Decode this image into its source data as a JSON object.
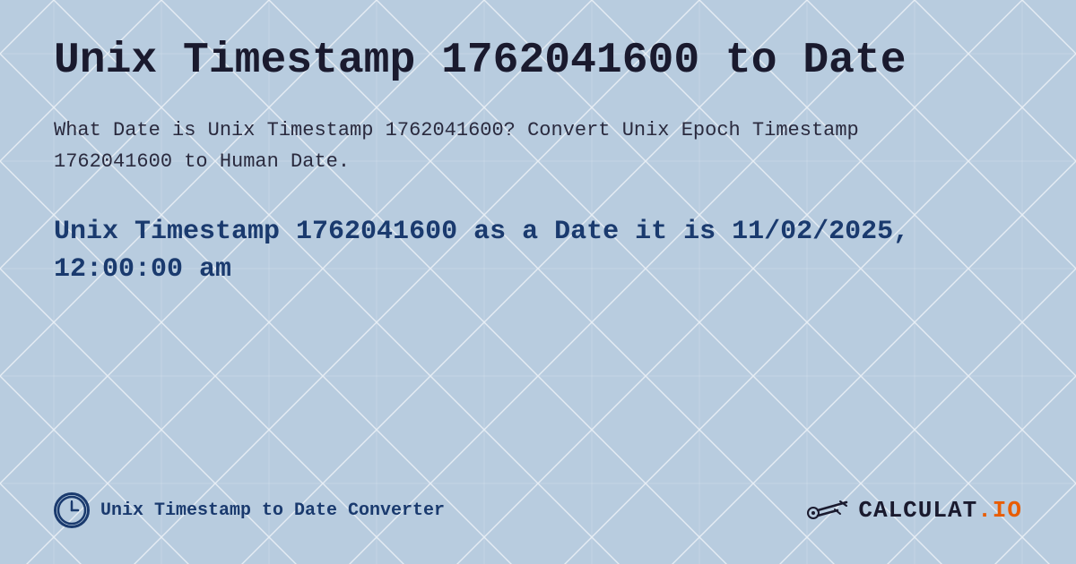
{
  "background": {
    "color": "#c8d8e8"
  },
  "header": {
    "title": "Unix Timestamp 1762041600 to Date"
  },
  "description": {
    "text": "What Date is Unix Timestamp 1762041600? Convert Unix Epoch Timestamp 1762041600 to Human Date."
  },
  "result": {
    "label": "Unix Timestamp 1762041600 as a Date it is 11/02/2025, 12:00:00 am"
  },
  "footer": {
    "converter_label": "Unix Timestamp to Date Converter",
    "logo_text": "CALCULAT.IO"
  }
}
